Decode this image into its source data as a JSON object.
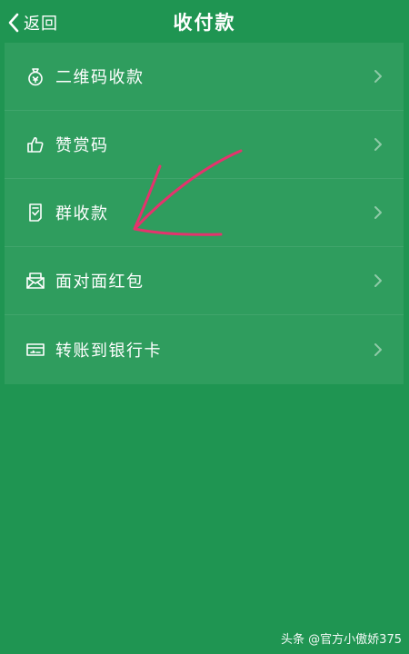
{
  "nav": {
    "back_label": "返回",
    "title": "收付款"
  },
  "menu": {
    "items": [
      {
        "label": "二维码收款",
        "icon": "money-bag-icon"
      },
      {
        "label": "赞赏码",
        "icon": "thumbs-up-icon"
      },
      {
        "label": "群收款",
        "icon": "group-receipt-icon"
      },
      {
        "label": "面对面红包",
        "icon": "red-envelope-icon"
      },
      {
        "label": "转账到银行卡",
        "icon": "bank-card-icon"
      }
    ]
  },
  "watermark": "头条 @官方小傲娇375",
  "colors": {
    "background": "#1f9552",
    "menu_background": "#2f9d5e",
    "annotation_arrow": "#e5336d"
  }
}
